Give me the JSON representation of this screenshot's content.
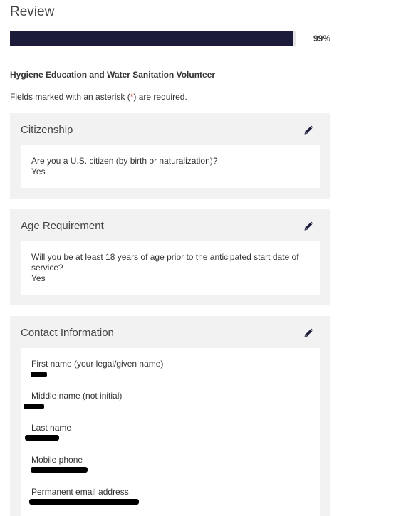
{
  "page": {
    "title": "Review",
    "progress_value": 0.99,
    "progress_label": "99%",
    "job_title": "Hygiene Education and Water Sanitation Volunteer",
    "required_note_prefix": "Fields marked with an asterisk (",
    "required_note_asterisk": "*",
    "required_note_suffix": ") are required."
  },
  "sections": {
    "citizenship": {
      "title": "Citizenship",
      "edit_icon": "pencil-icon",
      "question": "Are you a U.S. citizen (by birth or naturalization)?",
      "answer": "Yes"
    },
    "age": {
      "title": "Age Requirement",
      "edit_icon": "pencil-icon",
      "question": "Will you be at least 18 years of age prior to the anticipated start date of service?",
      "answer": "Yes"
    },
    "contact": {
      "title": "Contact Information",
      "edit_icon": "pencil-icon",
      "fields": [
        {
          "label": "First name (your legal/given name)"
        },
        {
          "label": "Middle name (not initial)"
        },
        {
          "label": "Last name"
        },
        {
          "label": "Mobile phone"
        },
        {
          "label": "Permanent email address"
        }
      ]
    }
  },
  "colors": {
    "progress_fill": "#1c1c3a",
    "progress_track": "#e6e6e6",
    "section_bg": "#f2f2f2",
    "asterisk": "#c0392b",
    "edit_icon": "#1c1c3a"
  }
}
